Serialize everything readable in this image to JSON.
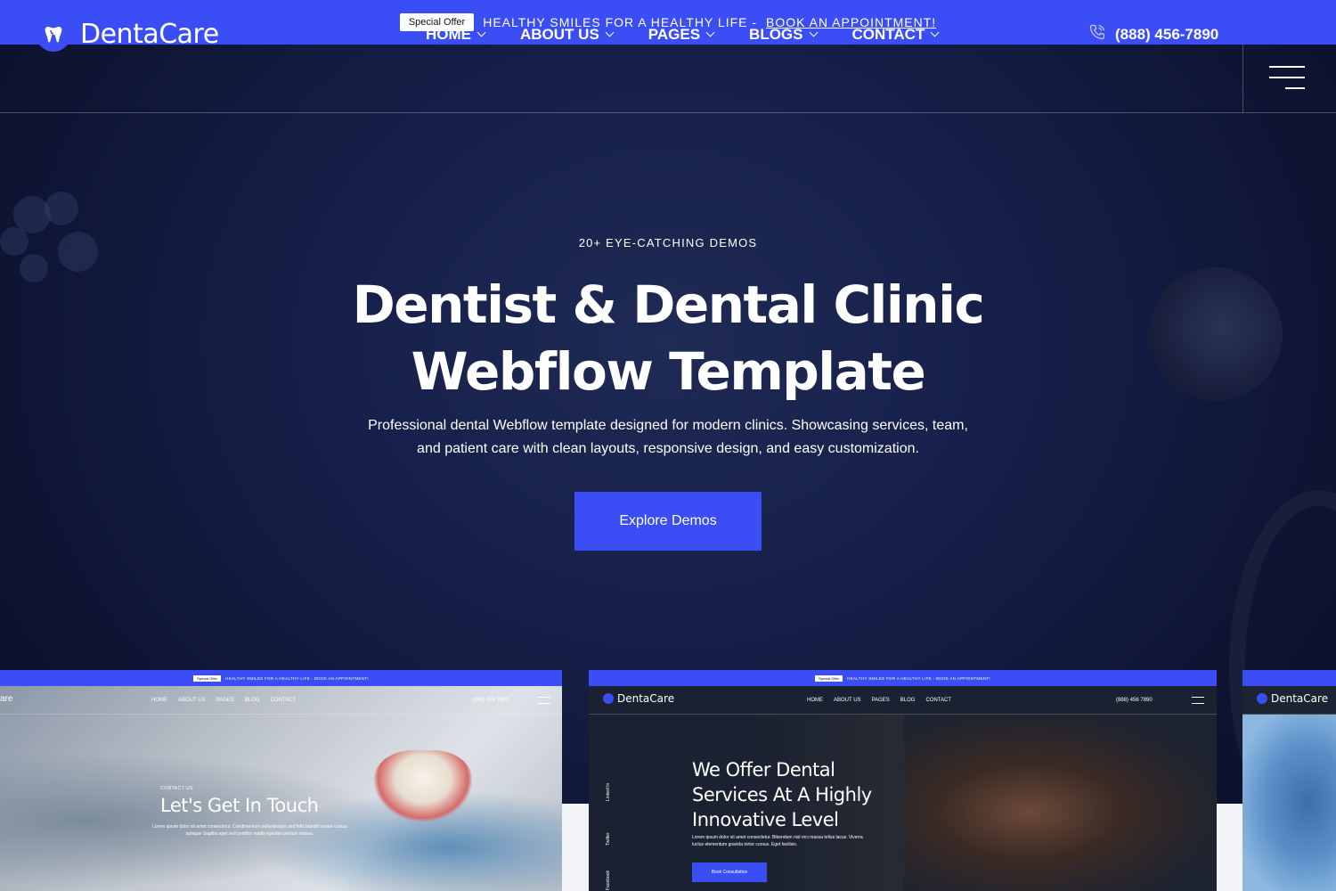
{
  "topbar": {
    "badge": "Special Offer",
    "message": "HEALTHY SMILES FOR A HEALTHY LIFE - ",
    "link": "BOOK AN APPOINTMENT!"
  },
  "brand": {
    "name": "DentaCare"
  },
  "nav": {
    "items": [
      {
        "label": "HOME"
      },
      {
        "label": "ABOUT US"
      },
      {
        "label": "PAGES"
      },
      {
        "label": "BLOGS"
      },
      {
        "label": "CONTACT"
      }
    ],
    "phone": "(888) 456-7890"
  },
  "hero": {
    "eyebrow": "20+ EYE-CATCHING DEMOS",
    "title_line1": "Dentist & Dental Clinic",
    "title_line2": "Webflow Template",
    "description": "Professional dental Webflow template designed for modern clinics. Showcasing services, team, and patient care with clean layouts, responsive design, and easy customization.",
    "cta": "Explore Demos"
  },
  "previews": {
    "card1": {
      "badge": "Special Offer",
      "message": "HEALTHY SMILES FOR A HEALTHY LIFE - BOOK AN APPOINTMENT!",
      "brand_fragment": "are",
      "nav": [
        "HOME",
        "ABOUT US",
        "PAGES",
        "BLOG",
        "CONTACT"
      ],
      "phone": "(888) 456 7890",
      "eyebrow": "CONTACT US",
      "heading": "Let's Get In Touch",
      "body": "Lorem ipsum dolor sit amet consectetur. Condimentum pellentesque sed felis blandit ornare cursus quisque Sagittis eget sed porttitor mattis egestas pretium massa."
    },
    "card2": {
      "badge": "Special Offer",
      "message": "HEALTHY SMILES FOR A HEALTHY LIFE - BOOK AN APPOINTMENT!",
      "brand": "DentaCare",
      "nav": [
        "HOME",
        "ABOUT US",
        "PAGES",
        "BLOG",
        "CONTACT"
      ],
      "phone": "(888) 456 7890",
      "heading_line1": "We Offer Dental",
      "heading_line2": "Services At A Highly",
      "heading_line3": "Innovative Level",
      "body": "Lorem ipsum dolor sit amet consectetur. Bibendum nisl orci massa tellus lacus. Viverra luctus elementum gravida tortor cursus. Eget facilisis.",
      "cta": "Book Consultation",
      "social": [
        "Linked In",
        "Twitter",
        "Facebook"
      ]
    },
    "card3": {
      "brand": "DentaCare"
    }
  },
  "colors": {
    "accent": "#3b4ef5",
    "hero_bg": "#16204a"
  }
}
